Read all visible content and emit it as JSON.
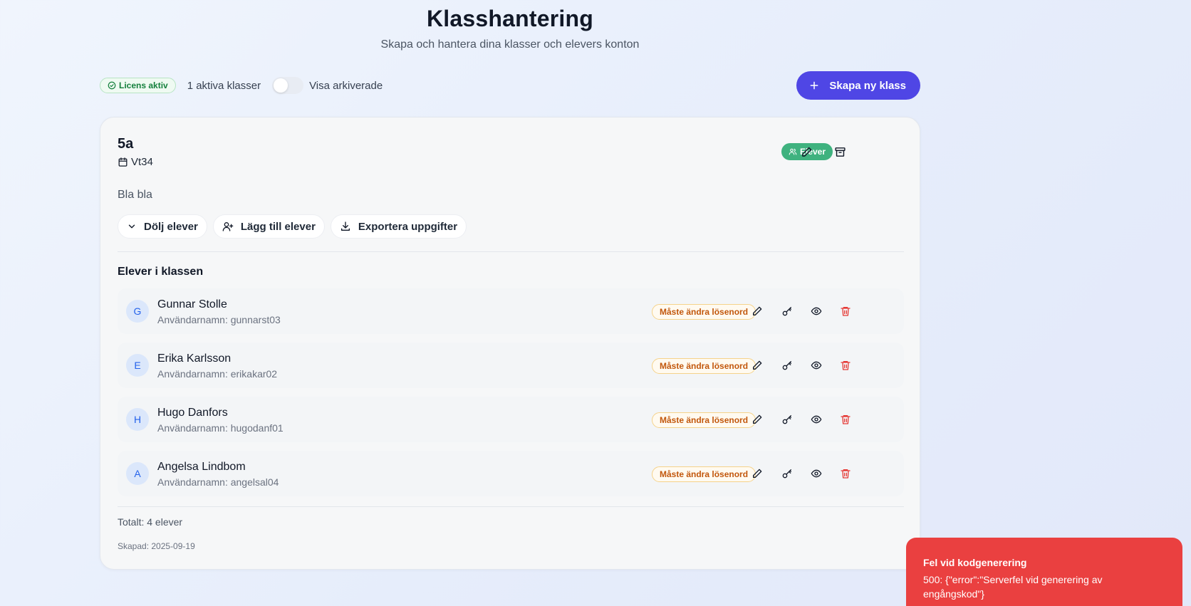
{
  "header": {
    "title": "Klasshantering",
    "subtitle": "Skapa och hantera dina klasser och elevers konton"
  },
  "toolbar": {
    "license_badge": "Licens aktiv",
    "active_classes": "1 aktiva klasser",
    "archived_toggle": {
      "label": "Visa arkiverade",
      "checked": false
    },
    "create_button": "Skapa ny klass"
  },
  "class_card": {
    "name": "5a",
    "term": "Vt34",
    "students_badge": "Elever",
    "description": "Bla bla",
    "actions": {
      "hide_students": "Dölj elever",
      "add_students": "Lägg till elever",
      "export": "Exportera uppgifter"
    },
    "students_heading": "Elever i klassen",
    "students": [
      {
        "initial": "G",
        "name": "Gunnar Stolle",
        "username": "Användarnamn: gunnarst03",
        "status": "Måste ändra lösenord"
      },
      {
        "initial": "E",
        "name": "Erika Karlsson",
        "username": "Användarnamn: erikakar02",
        "status": "Måste ändra lösenord"
      },
      {
        "initial": "H",
        "name": "Hugo Danfors",
        "username": "Användarnamn: hugodanf01",
        "status": "Måste ändra lösenord"
      },
      {
        "initial": "A",
        "name": "Angelsa Lindbom",
        "username": "Användarnamn: angelsal04",
        "status": "Måste ändra lösenord"
      }
    ],
    "total": "Totalt: 4 elever",
    "created": "Skapad: 2025-09-19"
  },
  "toast": {
    "title": "Fel vid kodgenerering",
    "message": "500: {\"error\":\"Serverfel vid generering av engångskod\"}"
  },
  "icons": {
    "license": "check-circle-icon",
    "create": "plus-icon",
    "term": "calendar-icon",
    "students_badge": "users-icon",
    "edit": "pencil-icon",
    "archive": "archive-icon",
    "hide": "chevron-down-icon",
    "add": "user-plus-icon",
    "export": "download-icon",
    "reset_password": "key-icon",
    "view": "eye-icon",
    "delete": "trash-icon"
  },
  "colors": {
    "primary": "#4f46e5",
    "success": "#3fb27f",
    "warning": "#c2570c",
    "danger": "#ea4040",
    "avatar_text": "#2563eb"
  }
}
